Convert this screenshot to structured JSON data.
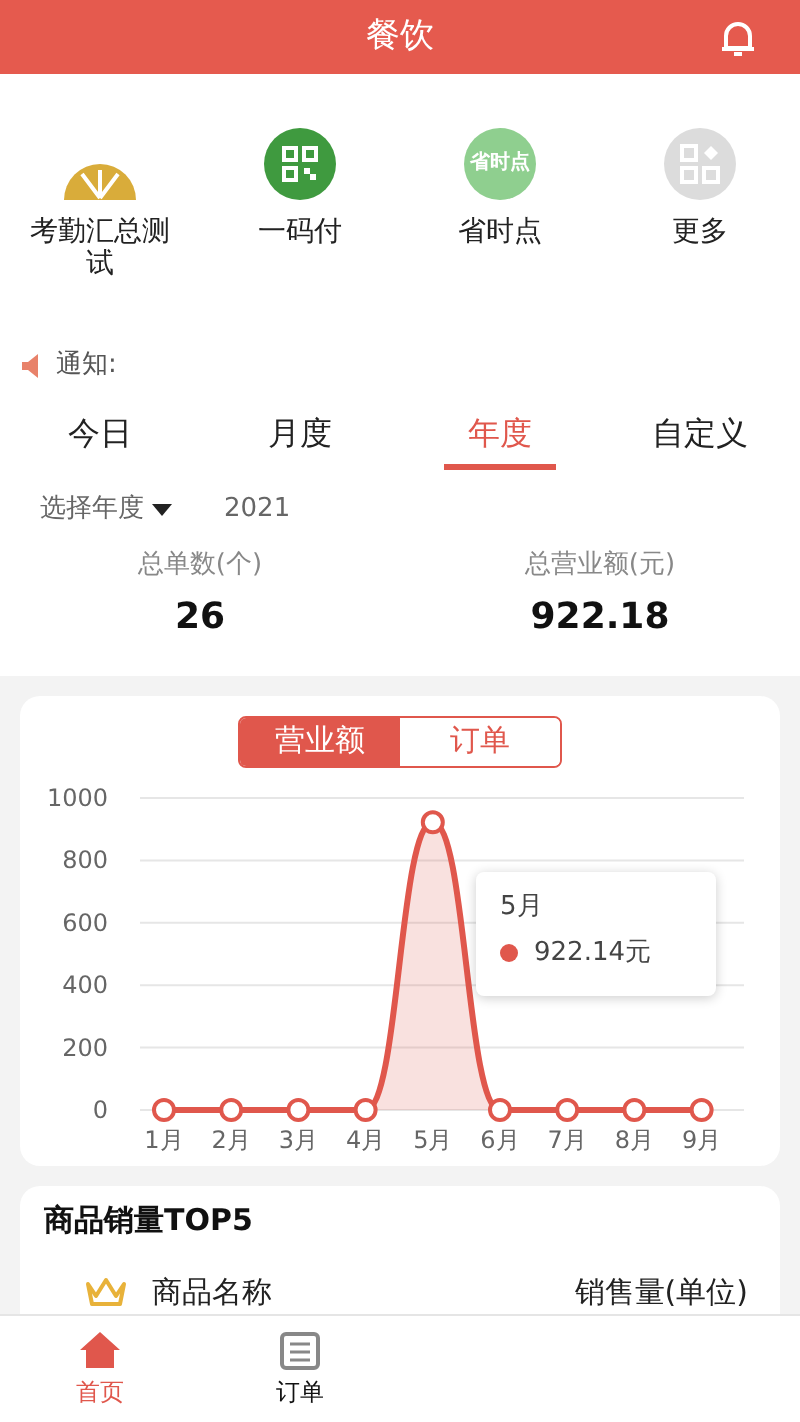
{
  "header": {
    "title": "餐饮"
  },
  "shortcuts": [
    {
      "label": "考勤汇总测试",
      "kind": "fan"
    },
    {
      "label": "一码付",
      "kind": "qr"
    },
    {
      "label": "省时点",
      "kind": "badge",
      "badge_text": "省时点"
    },
    {
      "label": "更多",
      "kind": "more"
    }
  ],
  "notice": {
    "label": "通知:"
  },
  "period_tabs": [
    {
      "label": "今日",
      "selected": false
    },
    {
      "label": "月度",
      "selected": false
    },
    {
      "label": "年度",
      "selected": true
    },
    {
      "label": "自定义",
      "selected": false
    }
  ],
  "year_select": {
    "label": "选择年度",
    "value": "2021"
  },
  "stats": [
    {
      "label": "总单数(个)",
      "value": "26"
    },
    {
      "label": "总营业额(元)",
      "value": "922.18"
    }
  ],
  "chart_toggle": [
    {
      "label": "营业额",
      "selected": true
    },
    {
      "label": "订单",
      "selected": false
    }
  ],
  "chart": {
    "chart_data": {
      "type": "area",
      "categories": [
        "1月",
        "2月",
        "3月",
        "4月",
        "5月",
        "6月",
        "7月",
        "8月",
        "9月"
      ],
      "grid": true,
      "series": [
        {
          "color": "#e0574c",
          "values": [
            0,
            0,
            0,
            0,
            922.14,
            0,
            0,
            0,
            0
          ]
        }
      ],
      "ylim": [
        0,
        1000
      ],
      "yticks": [
        0,
        200,
        400,
        600,
        800,
        1000
      ]
    },
    "tooltip": {
      "title": "5月",
      "value": "922.14元"
    }
  },
  "top5": {
    "title": "商品销量TOP5",
    "columns": [
      "商品名称",
      "销售量(单位)"
    ]
  },
  "bottom_tabs": [
    {
      "label": "首页",
      "selected": true,
      "kind": "home"
    },
    {
      "label": "订单",
      "selected": false,
      "kind": "list"
    }
  ]
}
